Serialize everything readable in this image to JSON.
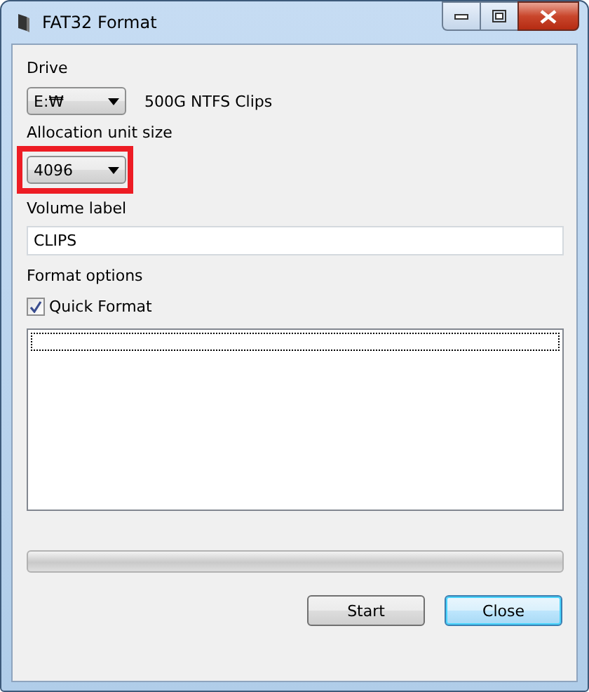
{
  "window": {
    "title": "FAT32 Format"
  },
  "drive": {
    "label": "Drive",
    "value": "E:₩",
    "description": "500G NTFS Clips"
  },
  "allocation": {
    "label": "Allocation unit size",
    "value": "4096",
    "highlighted": true
  },
  "volume": {
    "label": "Volume label",
    "value": "CLIPS"
  },
  "options": {
    "label": "Format options"
  },
  "quick_format": {
    "label": "Quick Format",
    "checked": true
  },
  "progress": {
    "level": 0
  },
  "buttons": [
    {
      "label": "Start",
      "default": false
    },
    {
      "label": "Close",
      "default": true
    }
  ]
}
